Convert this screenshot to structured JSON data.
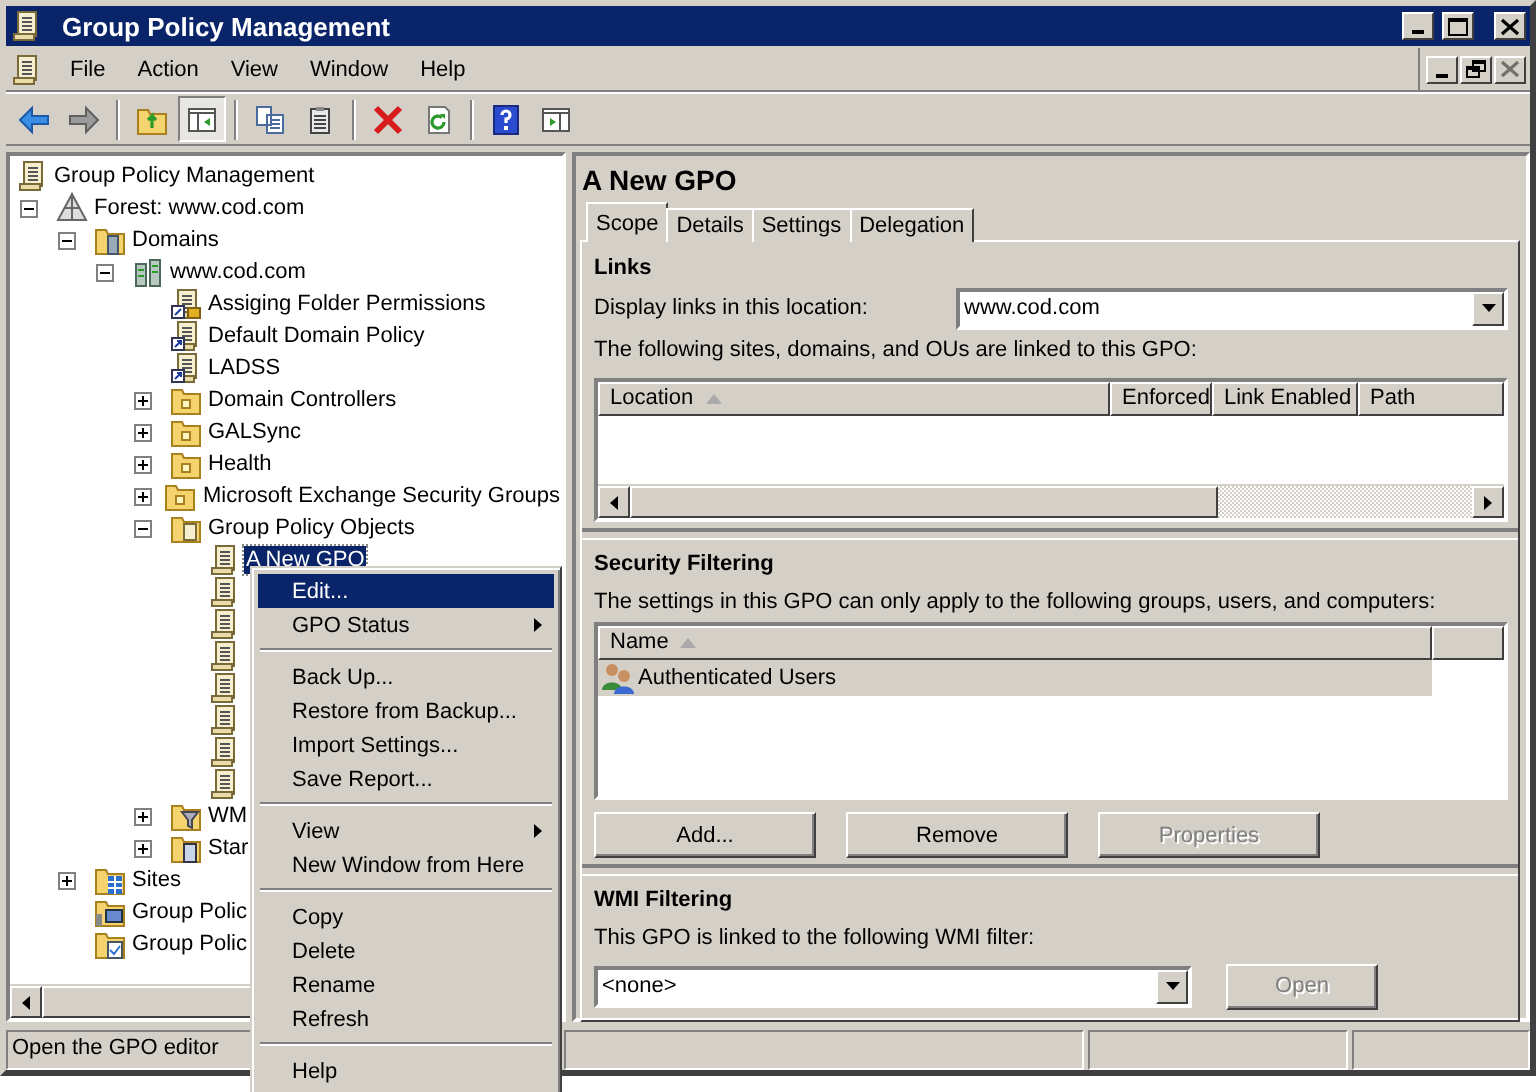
{
  "window": {
    "title": "Group Policy Management",
    "controls": [
      {
        "kind": "minimize",
        "disabled": false
      },
      {
        "kind": "maximize",
        "disabled": false
      },
      {
        "kind": "close",
        "disabled": false
      }
    ]
  },
  "menu_bar": {
    "items": [
      "File",
      "Action",
      "View",
      "Window",
      "Help"
    ],
    "document_controls": [
      {
        "kind": "minimize",
        "disabled": false
      },
      {
        "kind": "restore",
        "disabled": false
      },
      {
        "kind": "close",
        "disabled": true
      }
    ]
  },
  "toolbar": [
    {
      "kind": "back",
      "pressed": false
    },
    {
      "kind": "forward",
      "pressed": false
    },
    {
      "kind": "separator"
    },
    {
      "kind": "up",
      "pressed": false
    },
    {
      "kind": "tree-pane",
      "pressed": true
    },
    {
      "kind": "separator"
    },
    {
      "kind": "copy",
      "pressed": false
    },
    {
      "kind": "paste",
      "pressed": false
    },
    {
      "kind": "separator"
    },
    {
      "kind": "delete",
      "pressed": false
    },
    {
      "kind": "refresh",
      "pressed": false
    },
    {
      "kind": "separator"
    },
    {
      "kind": "help",
      "pressed": false
    },
    {
      "kind": "action-pane",
      "pressed": false
    }
  ],
  "tree": [
    {
      "label": "Group Policy Management",
      "kind": "console",
      "selected": false,
      "children": [
        {
          "label": "Forest: www.cod.com",
          "kind": "forest",
          "selected": false,
          "expanded": true,
          "children": [
            {
              "label": "Domains",
              "kind": "domains",
              "selected": false,
              "expanded": true,
              "children": [
                {
                  "label": "www.cod.com",
                  "kind": "domain",
                  "selected": false,
                  "expanded": true,
                  "children": [
                    {
                      "label": "Assiging Folder Permissions",
                      "kind": "gpo-link-locked",
                      "selected": false
                    },
                    {
                      "label": "Default Domain Policy",
                      "kind": "gpo-link",
                      "selected": false
                    },
                    {
                      "label": "LADSS",
                      "kind": "gpo-link",
                      "selected": false
                    },
                    {
                      "label": "Domain Controllers",
                      "kind": "ou",
                      "selected": false,
                      "expanded": false
                    },
                    {
                      "label": "GALSync",
                      "kind": "ou",
                      "selected": false,
                      "expanded": false
                    },
                    {
                      "label": "Health",
                      "kind": "ou",
                      "selected": false,
                      "expanded": false
                    },
                    {
                      "label": "Microsoft Exchange Security Groups",
                      "kind": "ou",
                      "selected": false,
                      "expanded": false
                    },
                    {
                      "label": "Group Policy Objects",
                      "kind": "gpo-folder",
                      "selected": false,
                      "expanded": true,
                      "children": [
                        {
                          "label": "A New GPO",
                          "kind": "gpo",
                          "selected": true
                        },
                        {
                          "kind": "gpo",
                          "selected": false
                        },
                        {
                          "kind": "gpo",
                          "selected": false
                        },
                        {
                          "kind": "gpo",
                          "selected": false
                        },
                        {
                          "kind": "gpo",
                          "selected": false
                        },
                        {
                          "kind": "gpo",
                          "selected": false
                        },
                        {
                          "kind": "gpo",
                          "selected": false
                        },
                        {
                          "kind": "gpo",
                          "selected": false
                        }
                      ]
                    },
                    {
                      "label": "WM",
                      "kind": "wmi-folder",
                      "selected": false,
                      "expanded": false
                    },
                    {
                      "label": "Star",
                      "kind": "starter-folder",
                      "selected": false,
                      "expanded": false
                    }
                  ]
                }
              ]
            },
            {
              "label": "Sites",
              "kind": "sites",
              "selected": false,
              "expanded": false
            },
            {
              "label": "Group Polic",
              "kind": "modeling",
              "selected": false
            },
            {
              "label": "Group Polic",
              "kind": "results",
              "selected": false
            }
          ]
        }
      ]
    }
  ],
  "context_menu": [
    {
      "kind": "item",
      "label": "Edit...",
      "selected": true,
      "submenu": false
    },
    {
      "kind": "item",
      "label": "GPO Status",
      "selected": false,
      "submenu": true
    },
    {
      "kind": "separator"
    },
    {
      "kind": "item",
      "label": "Back Up...",
      "selected": false,
      "submenu": false
    },
    {
      "kind": "item",
      "label": "Restore from Backup...",
      "selected": false,
      "submenu": false
    },
    {
      "kind": "item",
      "label": "Import Settings...",
      "selected": false,
      "submenu": false
    },
    {
      "kind": "item",
      "label": "Save Report...",
      "selected": false,
      "submenu": false
    },
    {
      "kind": "separator"
    },
    {
      "kind": "item",
      "label": "View",
      "selected": false,
      "submenu": true
    },
    {
      "kind": "item",
      "label": "New Window from Here",
      "selected": false,
      "submenu": false
    },
    {
      "kind": "separator"
    },
    {
      "kind": "item",
      "label": "Copy",
      "selected": false,
      "submenu": false
    },
    {
      "kind": "item",
      "label": "Delete",
      "selected": false,
      "submenu": false
    },
    {
      "kind": "item",
      "label": "Rename",
      "selected": false,
      "submenu": false
    },
    {
      "kind": "item",
      "label": "Refresh",
      "selected": false,
      "submenu": false
    },
    {
      "kind": "separator"
    },
    {
      "kind": "item",
      "label": "Help",
      "selected": false,
      "submenu": false
    }
  ],
  "details": {
    "title": "A New GPO",
    "tabs": [
      {
        "label": "Scope",
        "selected": true
      },
      {
        "label": "Details",
        "selected": false
      },
      {
        "label": "Settings",
        "selected": false
      },
      {
        "label": "Delegation",
        "selected": false
      }
    ],
    "links": {
      "heading": "Links",
      "location_label": "Display links in this location:",
      "location_value": "www.cod.com",
      "description": "The following sites, domains, and OUs are linked to this GPO:",
      "columns": [
        {
          "label": "Location",
          "sorted": true
        },
        {
          "label": "Enforced",
          "sorted": false
        },
        {
          "label": "Link Enabled",
          "sorted": false
        },
        {
          "label": "Path",
          "sorted": false
        }
      ]
    },
    "security_filtering": {
      "heading": "Security Filtering",
      "description": "The settings in this GPO can only apply to the following groups, users, and computers:",
      "columns": [
        {
          "label": "Name",
          "sorted": true
        }
      ],
      "rows": [
        {
          "name": "Authenticated Users",
          "selected": true
        }
      ],
      "buttons": [
        {
          "label": "Add...",
          "disabled": false
        },
        {
          "label": "Remove",
          "disabled": false
        },
        {
          "label": "Properties",
          "disabled": true
        }
      ]
    },
    "wmi_filtering": {
      "heading": "WMI Filtering",
      "description": "This GPO is linked to the following WMI filter:",
      "value": "<none>",
      "button": {
        "label": "Open",
        "disabled": true
      }
    }
  },
  "status_bar": [
    "Open the GPO editor"
  ]
}
